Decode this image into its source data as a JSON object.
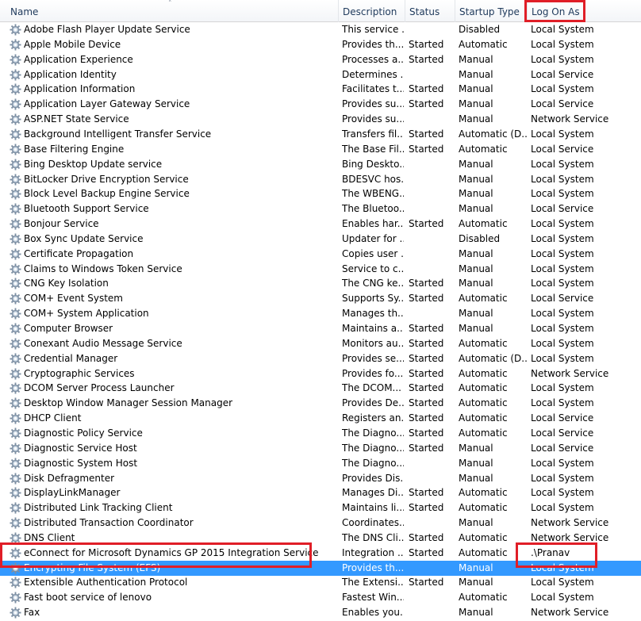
{
  "columns": {
    "name": "Name",
    "description": "Description",
    "status": "Status",
    "startup_type": "Startup Type",
    "log_on_as": "Log On As"
  },
  "sort_icon": "sort-ascending-icon",
  "row_icon": "service-gear-icon",
  "colors": {
    "selection": "#3399ff",
    "highlight": "#e01e27"
  },
  "selected_index": 36,
  "rows": [
    {
      "name": "Adobe Flash Player Update Service",
      "description": "This service ...",
      "status": "",
      "startup": "Disabled",
      "logon": "Local System"
    },
    {
      "name": "Apple Mobile Device",
      "description": "Provides th...",
      "status": "Started",
      "startup": "Automatic",
      "logon": "Local System"
    },
    {
      "name": "Application Experience",
      "description": "Processes a...",
      "status": "Started",
      "startup": "Manual",
      "logon": "Local System"
    },
    {
      "name": "Application Identity",
      "description": "Determines ...",
      "status": "",
      "startup": "Manual",
      "logon": "Local Service"
    },
    {
      "name": "Application Information",
      "description": "Facilitates t...",
      "status": "Started",
      "startup": "Manual",
      "logon": "Local System"
    },
    {
      "name": "Application Layer Gateway Service",
      "description": "Provides su...",
      "status": "Started",
      "startup": "Manual",
      "logon": "Local Service"
    },
    {
      "name": "ASP.NET State Service",
      "description": "Provides su...",
      "status": "",
      "startup": "Manual",
      "logon": "Network Service"
    },
    {
      "name": "Background Intelligent Transfer Service",
      "description": "Transfers fil...",
      "status": "Started",
      "startup": "Automatic (D...",
      "logon": "Local System"
    },
    {
      "name": "Base Filtering Engine",
      "description": "The Base Fil...",
      "status": "Started",
      "startup": "Automatic",
      "logon": "Local Service"
    },
    {
      "name": "Bing Desktop Update service",
      "description": "Bing Deskto...",
      "status": "",
      "startup": "Manual",
      "logon": "Local System"
    },
    {
      "name": "BitLocker Drive Encryption Service",
      "description": "BDESVC hos...",
      "status": "",
      "startup": "Manual",
      "logon": "Local System"
    },
    {
      "name": "Block Level Backup Engine Service",
      "description": "The WBENG...",
      "status": "",
      "startup": "Manual",
      "logon": "Local System"
    },
    {
      "name": "Bluetooth Support Service",
      "description": "The Bluetoo...",
      "status": "",
      "startup": "Manual",
      "logon": "Local Service"
    },
    {
      "name": "Bonjour Service",
      "description": "Enables har...",
      "status": "Started",
      "startup": "Automatic",
      "logon": "Local System"
    },
    {
      "name": "Box Sync Update Service",
      "description": "Updater for ...",
      "status": "",
      "startup": "Disabled",
      "logon": "Local System"
    },
    {
      "name": "Certificate Propagation",
      "description": "Copies user ...",
      "status": "",
      "startup": "Manual",
      "logon": "Local System"
    },
    {
      "name": "Claims to Windows Token Service",
      "description": "Service to c...",
      "status": "",
      "startup": "Manual",
      "logon": "Local System"
    },
    {
      "name": "CNG Key Isolation",
      "description": "The CNG ke...",
      "status": "Started",
      "startup": "Manual",
      "logon": "Local System"
    },
    {
      "name": "COM+ Event System",
      "description": "Supports Sy...",
      "status": "Started",
      "startup": "Automatic",
      "logon": "Local Service"
    },
    {
      "name": "COM+ System Application",
      "description": "Manages th...",
      "status": "",
      "startup": "Manual",
      "logon": "Local System"
    },
    {
      "name": "Computer Browser",
      "description": "Maintains a...",
      "status": "Started",
      "startup": "Manual",
      "logon": "Local System"
    },
    {
      "name": "Conexant Audio Message Service",
      "description": "Monitors au...",
      "status": "Started",
      "startup": "Automatic",
      "logon": "Local System"
    },
    {
      "name": "Credential Manager",
      "description": "Provides se...",
      "status": "Started",
      "startup": "Automatic (D...",
      "logon": "Local System"
    },
    {
      "name": "Cryptographic Services",
      "description": "Provides fo...",
      "status": "Started",
      "startup": "Automatic",
      "logon": "Network Service"
    },
    {
      "name": "DCOM Server Process Launcher",
      "description": "The DCOM...",
      "status": "Started",
      "startup": "Automatic",
      "logon": "Local System"
    },
    {
      "name": "Desktop Window Manager Session Manager",
      "description": "Provides De...",
      "status": "Started",
      "startup": "Automatic",
      "logon": "Local System"
    },
    {
      "name": "DHCP Client",
      "description": "Registers an...",
      "status": "Started",
      "startup": "Automatic",
      "logon": "Local Service"
    },
    {
      "name": "Diagnostic Policy Service",
      "description": "The Diagno...",
      "status": "Started",
      "startup": "Automatic",
      "logon": "Local Service"
    },
    {
      "name": "Diagnostic Service Host",
      "description": "The Diagno...",
      "status": "Started",
      "startup": "Manual",
      "logon": "Local Service"
    },
    {
      "name": "Diagnostic System Host",
      "description": "The Diagno...",
      "status": "",
      "startup": "Manual",
      "logon": "Local System"
    },
    {
      "name": "Disk Defragmenter",
      "description": "Provides Dis...",
      "status": "",
      "startup": "Manual",
      "logon": "Local System"
    },
    {
      "name": "DisplayLinkManager",
      "description": "Manages Di...",
      "status": "Started",
      "startup": "Automatic",
      "logon": "Local System"
    },
    {
      "name": "Distributed Link Tracking Client",
      "description": "Maintains li...",
      "status": "Started",
      "startup": "Automatic",
      "logon": "Local System"
    },
    {
      "name": "Distributed Transaction Coordinator",
      "description": "Coordinates...",
      "status": "",
      "startup": "Manual",
      "logon": "Network Service"
    },
    {
      "name": "DNS Client",
      "description": "The DNS Cli...",
      "status": "Started",
      "startup": "Automatic",
      "logon": "Network Service"
    },
    {
      "name": "eConnect for Microsoft Dynamics GP 2015 Integration Service",
      "description": "Integration ...",
      "status": "Started",
      "startup": "Automatic",
      "logon": ".\\Pranav"
    },
    {
      "name": "Encrypting File System (EFS)",
      "description": "Provides th...",
      "status": "",
      "startup": "Manual",
      "logon": "Local System"
    },
    {
      "name": "Extensible Authentication Protocol",
      "description": "The Extensi...",
      "status": "Started",
      "startup": "Manual",
      "logon": "Local System"
    },
    {
      "name": "Fast boot service of lenovo",
      "description": "Fastest Win...",
      "status": "",
      "startup": "Automatic",
      "logon": "Local System"
    },
    {
      "name": "Fax",
      "description": "Enables you...",
      "status": "",
      "startup": "Manual",
      "logon": "Network Service"
    }
  ]
}
